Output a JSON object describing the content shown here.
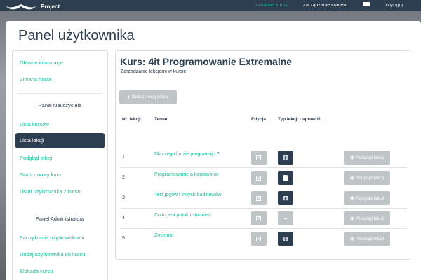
{
  "navbar": {
    "brand_text": "Project",
    "links": [
      {
        "label": "Ostatnie kursy",
        "active": true
      },
      {
        "label": "Zarządzanie kontem",
        "active": false
      },
      {
        "label": "Wyloguj",
        "active": false
      }
    ]
  },
  "page_title": "Panel użytkownika",
  "sidebar": {
    "items_top": [
      {
        "label": "Główne informacje"
      },
      {
        "label": "Zmiana hasła"
      }
    ],
    "teacher_header": "Panel Nauczyciela",
    "teacher_items": [
      {
        "label": "Lista kursów"
      },
      {
        "label": "Lista lekcji",
        "active": true
      },
      {
        "label": "Podgląd lekcji"
      },
      {
        "label": "Stwórz nowy kurs"
      },
      {
        "label": "Usuń użytkownika z kursu"
      }
    ],
    "admin_header": "Panel Administratora",
    "admin_items": [
      {
        "label": "Zarządzanie użytkownikami"
      },
      {
        "label": "Dodaj użytkownika do kursu"
      },
      {
        "label": "Blokada kursu"
      }
    ]
  },
  "content": {
    "title": "Kurs: 4it Programowanie Extremalne",
    "subtitle": "Zarządzanie lekcjami w kursie",
    "add_button": "Dodaj nową lekcję",
    "headers": {
      "num": "Nr. lekcji",
      "topic": "Temat",
      "edit": "Edycja",
      "type": "Typ lekcji - sprawdź"
    },
    "preview_label": "Podgląd lekcji",
    "rows": [
      {
        "num": "1",
        "topic": "Dlaczego ludzie programujo ?",
        "type_icon": "text-icon",
        "type_glyph": "ℿ"
      },
      {
        "num": "2",
        "topic": "Programowanie a kopiowanie",
        "type_icon": "document-icon",
        "type_glyph": "▮"
      },
      {
        "num": "3",
        "topic": "Test jpgów i innych badziewów",
        "type_icon": "text-icon",
        "type_glyph": "ℿ"
      },
      {
        "num": "4",
        "topic": "Co to jest potok i strumień",
        "type_icon": "minus-icon",
        "type_glyph": "−"
      },
      {
        "num": "5",
        "topic": "Zmienne",
        "type_icon": "text-icon",
        "type_glyph": "ℿ"
      }
    ]
  },
  "colors": {
    "navy": "#2c3e50",
    "accent": "#18bc9c",
    "button_gray": "#bfc4c7"
  }
}
